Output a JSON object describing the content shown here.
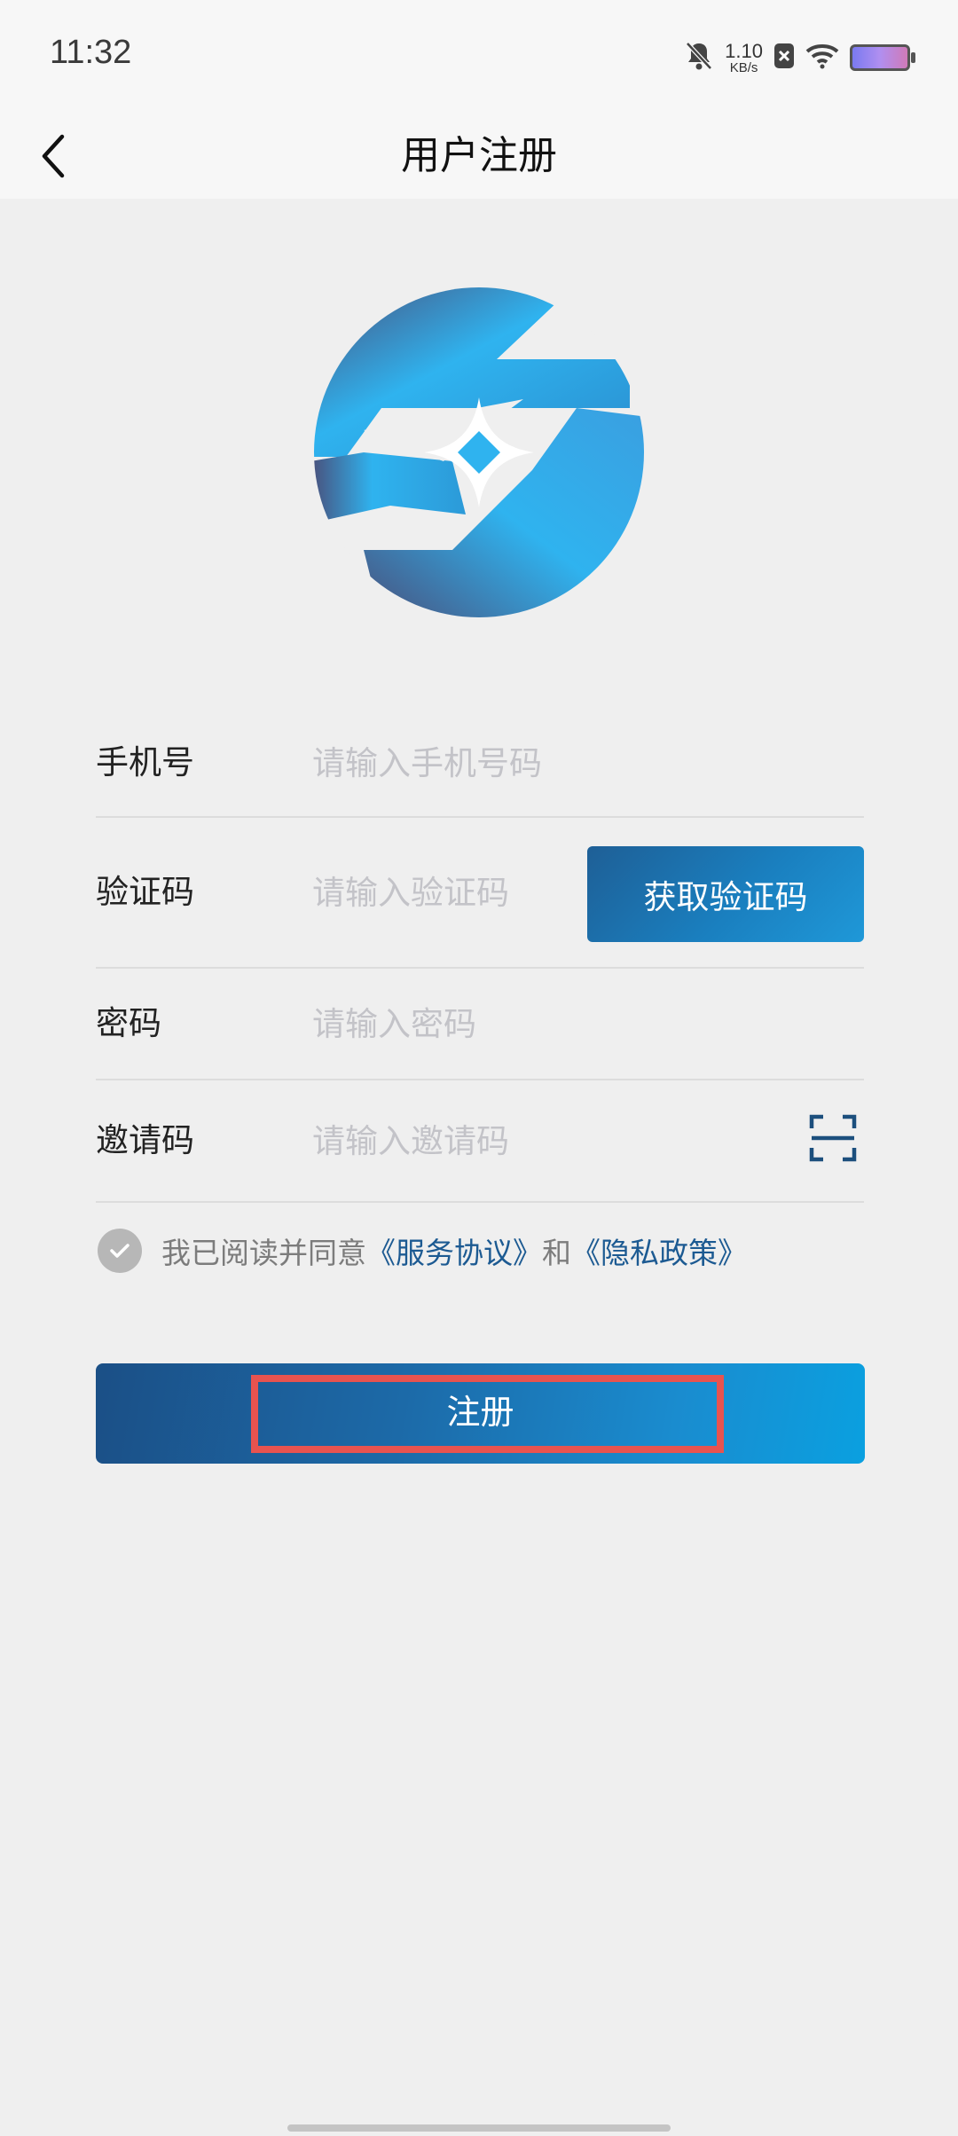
{
  "status_bar": {
    "time": "11:32",
    "net_speed_value": "1.10",
    "net_speed_unit": "KB/s",
    "icons": [
      "bell-muted-icon",
      "close-box-icon",
      "wifi-icon",
      "battery-icon"
    ]
  },
  "nav": {
    "title": "用户注册",
    "back_icon": "chevron-left-icon"
  },
  "logo": {
    "colors": {
      "light": "#2fb3ef",
      "dark": "#4a4f7a",
      "mid": "#2a8ecf"
    }
  },
  "form": {
    "phone": {
      "label": "手机号",
      "placeholder": "请输入手机号码"
    },
    "code": {
      "label": "验证码",
      "placeholder": "请输入验证码",
      "button": "获取验证码"
    },
    "password": {
      "label": "密码",
      "placeholder": "请输入密码"
    },
    "invite": {
      "label": "邀请码",
      "placeholder": "请输入邀请码",
      "scan_icon": "scan-icon"
    }
  },
  "agreement": {
    "prefix": "我已阅读并同意",
    "service_link": "《服务协议》",
    "and": "和",
    "privacy_link": "《隐私政策》",
    "checked": true
  },
  "register_button": {
    "label": "注册"
  },
  "theme": {
    "accent": "#1c6aa8",
    "link": "#1c5a92",
    "highlight": "#e8534f"
  }
}
